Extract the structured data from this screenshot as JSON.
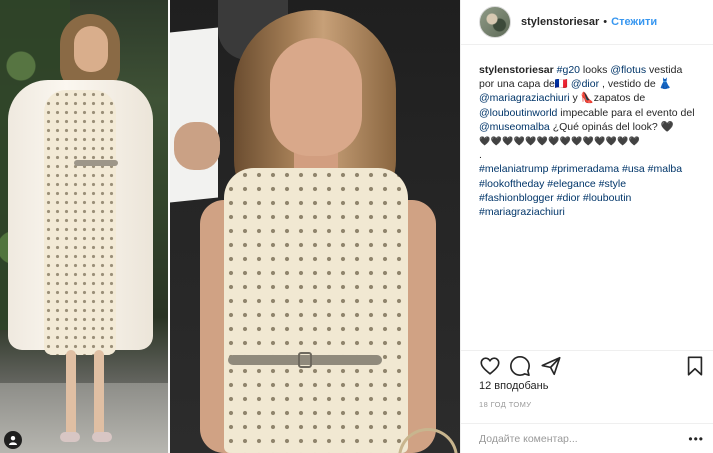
{
  "post": {
    "username": "stylenstoriesar",
    "follow_label": "Стежити",
    "separator": "•",
    "caption": {
      "line1_pre": "",
      "author": "stylenstoriesar",
      "t1": " ",
      "tag_g20": "#g20",
      "t2": " looks ",
      "mention_flotus": "@flotus",
      "t3": " vestida por una capa de",
      "emoji_a": "🇫🇷",
      "t4": " ",
      "mention_dior": "@dior",
      "t5": " , vestido de ",
      "emoji_dress": "👗",
      "mention_mgc": "@mariagraziachiuri",
      "t6": " y ",
      "emoji_shoes": "👠",
      "t7": "zapatos de ",
      "mention_louboutin": "@louboutinworld",
      "t8": " impecable para el evento del ",
      "mention_museo": "@museomalba",
      "t9": " ¿Qué opinás del look? ",
      "heart_end": "🖤",
      "hearts_row": "🖤🖤🖤🖤🖤🖤🖤🖤🖤🖤🖤🖤🖤🖤",
      "dot_line": ".",
      "hashtags": "#melaniatrump #primeradama #usa #malba #lookoftheday #elegance #style #fashionblogger #dior #louboutin #mariagraziachiuri"
    },
    "likes": "12 вподобань",
    "timestamp": "18 ГОД ТОМУ",
    "comment_placeholder": "Додайте коментар...",
    "more_label": "•••"
  },
  "icons": {
    "like": "heart-icon",
    "comment": "comment-icon",
    "share": "share-icon",
    "save": "bookmark-icon",
    "user_tag": "user-tag-icon"
  },
  "colors": {
    "accent": "#3897f0",
    "link": "#003569",
    "text": "#262626",
    "muted": "#999999",
    "border": "#efefef"
  }
}
